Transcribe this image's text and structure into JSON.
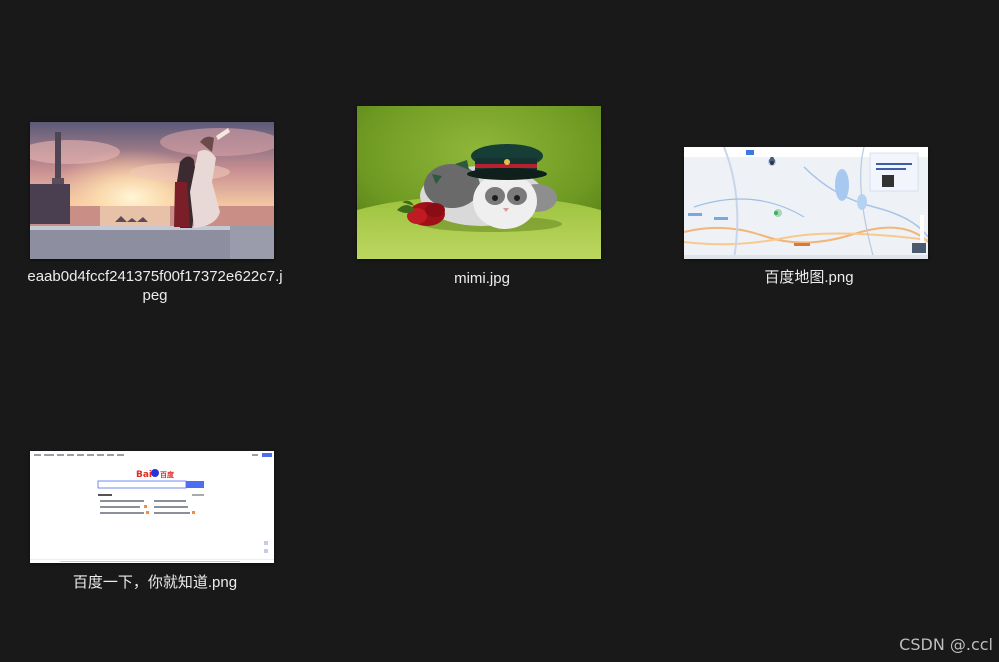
{
  "files": [
    {
      "name": "eaab0d4fccf241375f00f17372e622c7.jpeg",
      "thumb": "anime-sunset-image"
    },
    {
      "name": "mimi.jpg",
      "thumb": "cat-with-cap-image"
    },
    {
      "name": "百度地图.png",
      "thumb": "map-screenshot-image"
    },
    {
      "name": "百度一下，你就知道.png",
      "thumb": "search-page-screenshot-image"
    }
  ],
  "baidu_thumb": {
    "logo_text_bai": "Bai",
    "logo_text_du": "百度"
  },
  "watermark": "CSDN @.ccl"
}
